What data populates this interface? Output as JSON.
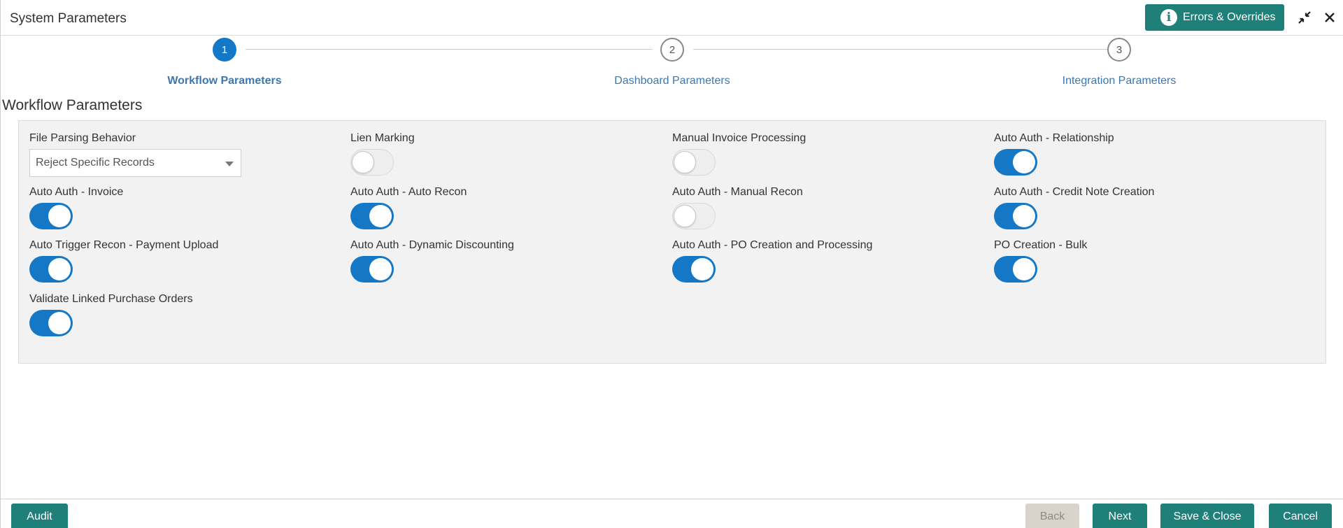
{
  "header": {
    "title": "System Parameters",
    "errors_button": "Errors & Overrides",
    "icons": [
      "info-icon",
      "minimize-icon",
      "close-icon"
    ]
  },
  "stepper": {
    "steps": [
      {
        "number": "1",
        "label": "Workflow Parameters",
        "state": "active"
      },
      {
        "number": "2",
        "label": "Dashboard Parameters",
        "state": "inactive"
      },
      {
        "number": "3",
        "label": "Integration Parameters",
        "state": "inactive"
      }
    ]
  },
  "section": {
    "title": "Workflow Parameters"
  },
  "fields": {
    "file_parsing": {
      "label": "File Parsing Behavior",
      "value": "Reject Specific Records"
    },
    "toggles": [
      {
        "label": "Lien Marking",
        "on": false
      },
      {
        "label": "Manual Invoice Processing",
        "on": false
      },
      {
        "label": "Auto Auth - Relationship",
        "on": true
      },
      {
        "label": "Auto Auth - Invoice",
        "on": true
      },
      {
        "label": "Auto Auth - Auto Recon",
        "on": true
      },
      {
        "label": "Auto Auth - Manual Recon",
        "on": false
      },
      {
        "label": "Auto Auth - Credit Note Creation",
        "on": true
      },
      {
        "label": "Auto Trigger Recon - Payment Upload",
        "on": true
      },
      {
        "label": "Auto Auth - Dynamic Discounting",
        "on": true
      },
      {
        "label": "Auto Auth - PO Creation and Processing",
        "on": true
      },
      {
        "label": "PO Creation - Bulk",
        "on": true
      },
      {
        "label": "Validate Linked Purchase Orders",
        "on": true
      }
    ]
  },
  "footer": {
    "audit": "Audit",
    "back": "Back",
    "next": "Next",
    "save_close": "Save & Close",
    "cancel": "Cancel"
  },
  "colors": {
    "primary_button": "#1f7f79",
    "toggle_on": "#1578c6",
    "step_active": "#1578c6",
    "step_label": "#3c77b0",
    "panel_bg": "#f2f2f2"
  }
}
